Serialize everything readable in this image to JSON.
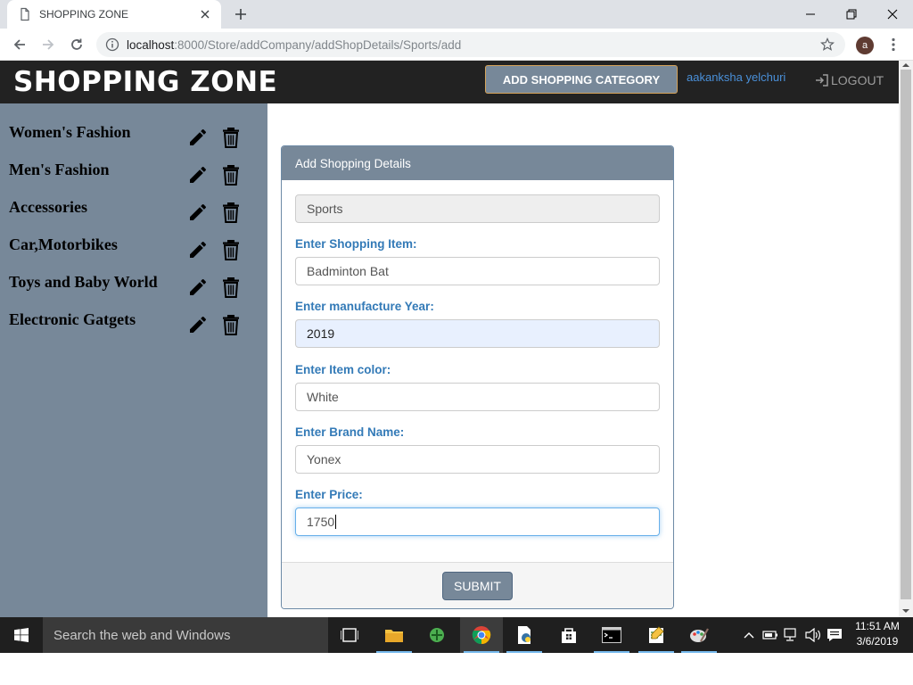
{
  "browser": {
    "tab_title": "SHOPPING ZONE",
    "url_host": "localhost",
    "url_rest": ":8000/Store/addCompany/addShopDetails/Sports/add",
    "avatar_letter": "a"
  },
  "header": {
    "brand": "SHOPPING ZONE",
    "add_category_label": "ADD SHOPPING CATEGORY",
    "username": "aakanksha yelchuri",
    "logout_label": "LOGOUT"
  },
  "sidebar": {
    "categories": [
      {
        "label": "Women's Fashion"
      },
      {
        "label": "Men's Fashion"
      },
      {
        "label": "Accessories"
      },
      {
        "label": "Car,Motorbikes"
      },
      {
        "label": "Toys and Baby World"
      },
      {
        "label": "Electronic Gatgets"
      }
    ]
  },
  "form": {
    "panel_title": "Add Shopping Details",
    "category_value": "Sports",
    "item_label": "Enter Shopping Item:",
    "item_value": "Badminton Bat",
    "year_label": "Enter manufacture Year:",
    "year_value": "2019",
    "color_label": "Enter Item color:",
    "color_value": "White",
    "brand_label": "Enter Brand Name:",
    "brand_value": "Yonex",
    "price_label": "Enter Price:",
    "price_value": "1750",
    "submit_label": "SUBMIT"
  },
  "taskbar": {
    "search_placeholder": "Search the web and Windows",
    "time": "11:51 AM",
    "date": "3/6/2019"
  },
  "colors": {
    "header_bg": "#222222",
    "slate_gray": "#778899",
    "label_blue": "#337ab7",
    "taskbar_bg": "#1f1f1f"
  }
}
